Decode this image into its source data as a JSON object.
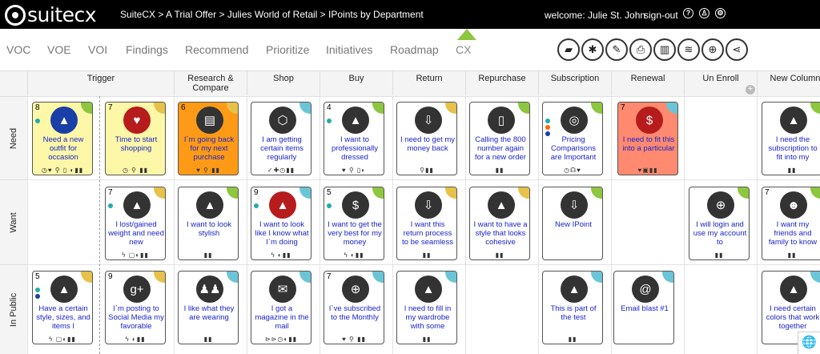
{
  "app": {
    "logo_text": "suitecx",
    "breadcrumb": "SuiteCX > A Trial Offer > Julies World of Retail > IPoints by Department",
    "welcome": "welcome: Julie St. John",
    "signout": "sign-out"
  },
  "tabs": [
    "VOC",
    "VOE",
    "VOI",
    "Findings",
    "Recommend",
    "Prioritize",
    "Initiatives",
    "Roadmap",
    "CX"
  ],
  "active_tab": "CX",
  "tools": [
    "note-icon",
    "asterisk-icon",
    "edit-icon",
    "print-icon",
    "map-icon",
    "database-icon",
    "target-icon",
    "share-icon"
  ],
  "columns": [
    "Trigger",
    "Research &\nCompare",
    "Shop",
    "Buy",
    "Return",
    "Repurchase",
    "Subscription",
    "Renewal",
    "Un Enroll",
    "New Column"
  ],
  "rows": [
    "Need",
    "Want",
    "In Public"
  ],
  "colors": {
    "yellow": "#fdf7a8",
    "orange": "#ff9a16",
    "salmon": "#ff8a70",
    "accent": "#8dc63f",
    "link": "#1a24c8"
  },
  "cards": [
    {
      "id": "c1",
      "num": "8",
      "text": "Need a new outfit for occasion",
      "bg": "yellow",
      "icon": "flame",
      "circle": "#1a3fa6",
      "corner": "#8dc63f",
      "dots": [
        "#2aa"
      ],
      "foot": "◷♥ ⚲ ▯ ◐▮▮"
    },
    {
      "id": "c2",
      "num": "7",
      "text": "Time to start shopping",
      "bg": "yellow",
      "icon": "heart",
      "circle": "#b71c1c",
      "corner": "#e7c24a",
      "dots": [],
      "foot": "◷ ⚲ ▮▮"
    },
    {
      "id": "c3",
      "num": "6",
      "text": "I`m going back for my next purchase",
      "bg": "orange",
      "icon": "store",
      "circle": "#333",
      "corner": "#e7c24a",
      "dots": [],
      "foot": "♥ ⚲ ▮▮"
    },
    {
      "id": "c4",
      "num": "",
      "text": "I am getting certain items regularly",
      "bg": "white",
      "icon": "box",
      "circle": "#333",
      "corner": "#6cc5d6",
      "dots": [],
      "foot": "✓✚◷▮▮"
    },
    {
      "id": "c5",
      "num": "4",
      "text": "I want to professionally dressed",
      "bg": "white",
      "icon": "flame",
      "circle": "#333",
      "corner": "#8dc63f",
      "dots": [
        "#2aa"
      ],
      "foot": "♥ ⚲ ▯◐"
    },
    {
      "id": "c6",
      "num": "",
      "text": "I need to get my money back",
      "bg": "white",
      "icon": "return",
      "circle": "#333",
      "corner": "#e7c24a",
      "dots": [],
      "foot": "⚲▮▮"
    },
    {
      "id": "c7",
      "num": "",
      "text": "Calling the 800 number again for a new order",
      "bg": "white",
      "icon": "phone",
      "circle": "#333",
      "corner": "#8dc63f",
      "dots": [],
      "foot": "▮▮"
    },
    {
      "id": "c8",
      "num": "",
      "text": "Pricing Comparisons are Important",
      "bg": "white",
      "icon": "target",
      "circle": "#333",
      "corner": "#8dc63f",
      "dots": [
        "#2aa",
        "#f60",
        "#1a3fa6"
      ],
      "foot": "◷☊♥"
    },
    {
      "id": "c9",
      "num": "7",
      "text": "I need to fit this into a particular",
      "bg": "salmon",
      "icon": "dollar",
      "circle": "#b71c1c",
      "corner": "#6cc5d6",
      "dots": [],
      "foot": "♥▣▮▮"
    },
    {
      "id": "c10",
      "num": "",
      "text": "I need the subscription to fit into my",
      "bg": "white",
      "icon": "flame",
      "circle": "#333",
      "corner": "#8dc63f",
      "dots": [],
      "foot": "▮▮"
    },
    {
      "id": "c11",
      "num": "7",
      "text": "I lost/gained weight and need new",
      "bg": "white",
      "icon": "flame",
      "circle": "#333",
      "corner": "#e7c24a",
      "dots": [
        "#2aa"
      ],
      "foot": "ϟ ▢◐▮▮"
    },
    {
      "id": "c12",
      "num": "",
      "text": "I want to look stylish",
      "bg": "white",
      "icon": "flame",
      "circle": "#333",
      "corner": "#8dc63f",
      "dots": [],
      "foot": "▮▮"
    },
    {
      "id": "c13",
      "num": "9",
      "text": "I want to look like I know what I`m doing",
      "bg": "white",
      "icon": "flame",
      "circle": "#b71c1c",
      "corner": "#6cc5d6",
      "dots": [
        "#2aa"
      ],
      "foot": "ϟ ◐▮▮"
    },
    {
      "id": "c14",
      "num": "5",
      "text": "I want to get the very best for my money",
      "bg": "white",
      "icon": "dollar",
      "circle": "#333",
      "corner": "#8dc63f",
      "dots": [
        "#2aa"
      ],
      "foot": "ϟ ◐▮▮"
    },
    {
      "id": "c15",
      "num": "",
      "text": "I want this return process to be seamless",
      "bg": "white",
      "icon": "return",
      "circle": "#333",
      "corner": "#e7c24a",
      "dots": [],
      "foot": "▮▮"
    },
    {
      "id": "c16",
      "num": "",
      "text": "I want to have a style that looks cohesive",
      "bg": "white",
      "icon": "flame",
      "circle": "#333",
      "corner": "#e7c24a",
      "dots": [],
      "foot": "▮▮"
    },
    {
      "id": "c17",
      "num": "",
      "text": "New IPoint",
      "bg": "white",
      "icon": "return",
      "circle": "#333",
      "corner": "#8dc63f",
      "dots": [],
      "foot": ""
    },
    {
      "id": "c18",
      "num": "",
      "text": "I will login and use my account to",
      "bg": "white",
      "icon": "globe",
      "circle": "#333",
      "corner": "#8dc63f",
      "dots": [],
      "foot": "▮▮"
    },
    {
      "id": "c19",
      "num": "7",
      "text": "I want my friends and family to know",
      "bg": "white",
      "icon": "chat",
      "circle": "#333",
      "corner": "#8dc63f",
      "dots": [],
      "foot": "▮▮"
    },
    {
      "id": "c20",
      "num": "5",
      "text": "Have a certain style, sizes, and items I",
      "bg": "white",
      "icon": "flame",
      "circle": "#333",
      "corner": "#e7c24a",
      "dots": [
        "#2aa",
        "#1a3fa6"
      ],
      "foot": "ϟ ▢◐▮▮"
    },
    {
      "id": "c21",
      "num": "9",
      "text": "I`m posting to Social Media my favorable",
      "bg": "white",
      "icon": "g+",
      "circle": "#333",
      "corner": "#e7c24a",
      "dots": [],
      "foot": "ϟ ◐▮▮"
    },
    {
      "id": "c22",
      "num": "",
      "text": "I like what they are wearing",
      "bg": "white",
      "icon": "people",
      "circle": "#333",
      "corner": "#6cc5d6",
      "dots": [],
      "foot": "▮▮"
    },
    {
      "id": "c23",
      "num": "",
      "text": "I got a magazine in the mail",
      "bg": "white",
      "icon": "mail",
      "circle": "#333",
      "corner": "#6cc5d6",
      "dots": [],
      "foot": "⊳⊳◷◐▮▮"
    },
    {
      "id": "c24",
      "num": "7",
      "text": "I`ve subscribed to the Monthly",
      "bg": "white",
      "icon": "globe",
      "circle": "#333",
      "corner": "#6cc5d6",
      "dots": [],
      "foot": "♥ ⚲ ▮▮"
    },
    {
      "id": "c25",
      "num": "",
      "text": "I need to fill in my wardrobe with some",
      "bg": "white",
      "icon": "flame",
      "circle": "#333",
      "corner": "#6cc5d6",
      "dots": [],
      "foot": "▮▮"
    },
    {
      "id": "c26",
      "num": "",
      "text": "This is part of the test",
      "bg": "white",
      "icon": "flame",
      "circle": "#333",
      "corner": "#6cc5d6",
      "dots": [],
      "foot": "▮▮"
    },
    {
      "id": "c27",
      "num": "",
      "text": "Email blast #1",
      "bg": "white",
      "icon": "at",
      "circle": "#333",
      "corner": "#6cc5d6",
      "dots": [],
      "foot": ""
    },
    {
      "id": "c28",
      "num": "",
      "text": "I need certain colors that work together",
      "bg": "white",
      "icon": "flame",
      "circle": "#333",
      "corner": "#6cc5d6",
      "dots": [],
      "foot": ""
    }
  ]
}
